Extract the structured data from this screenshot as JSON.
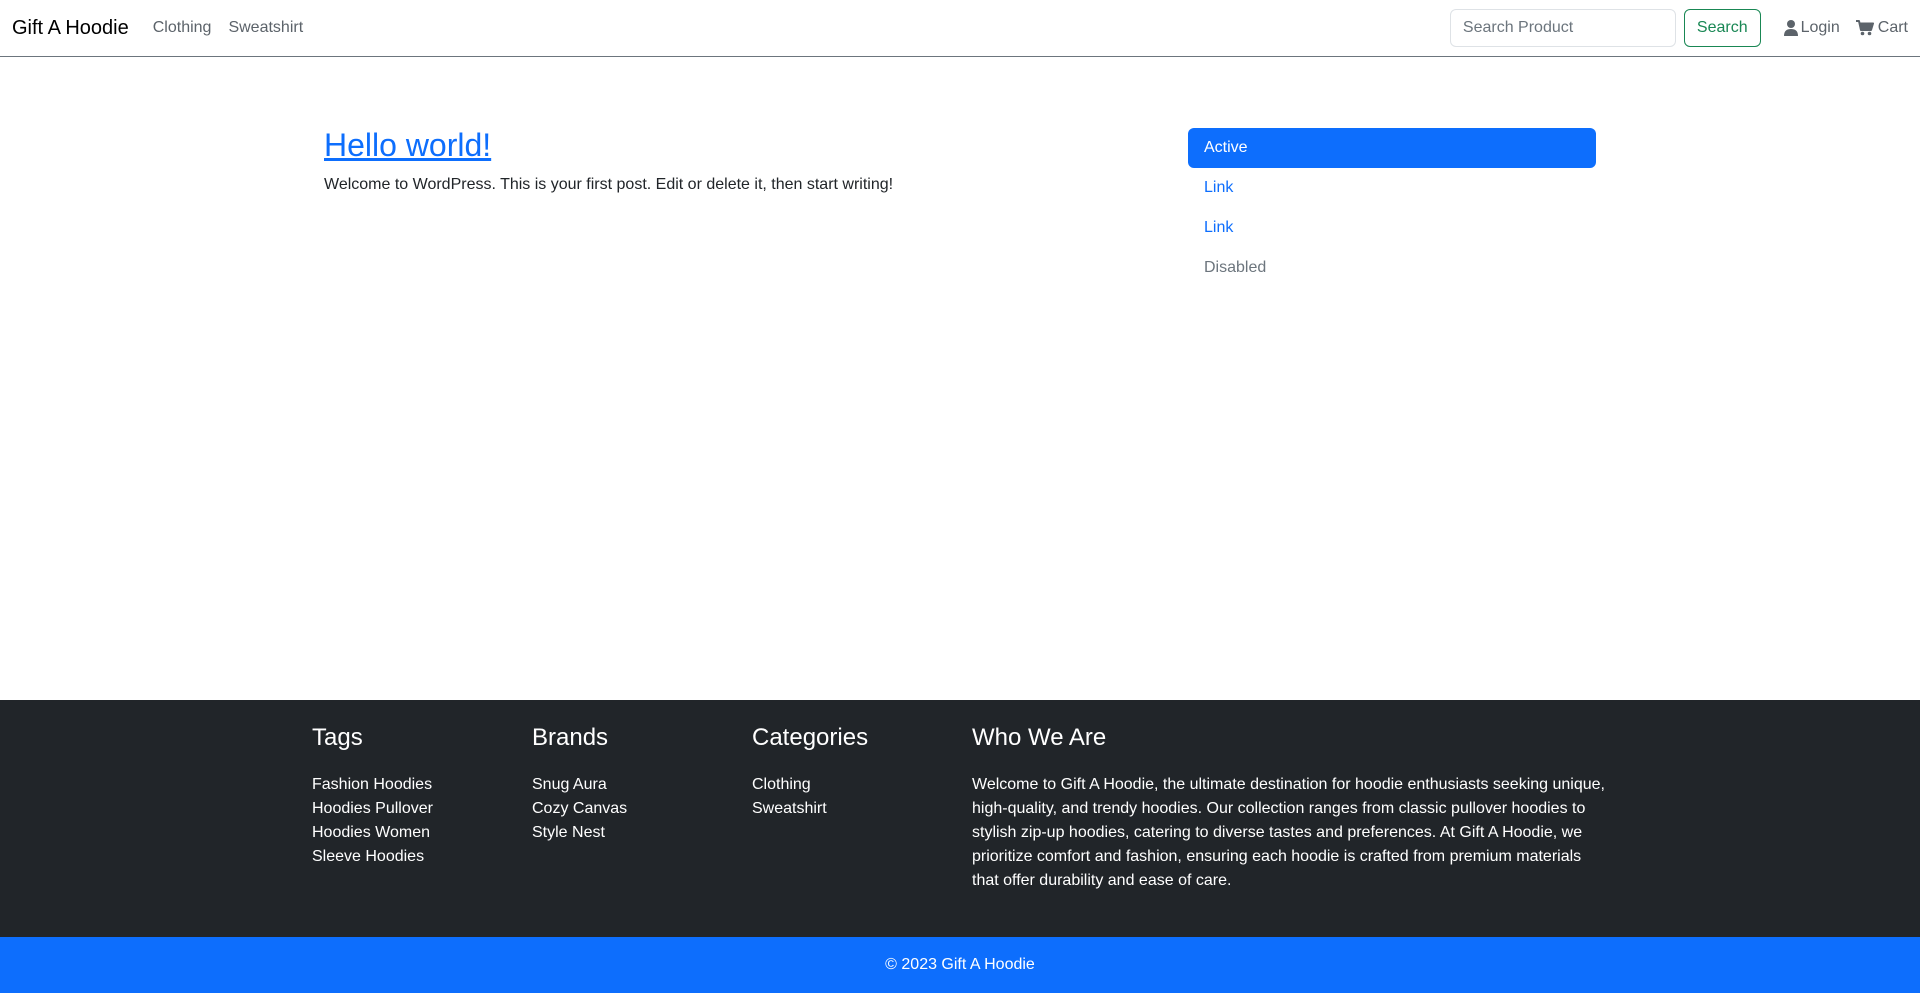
{
  "navbar": {
    "brand": "Gift A Hoodie",
    "links": [
      "Clothing",
      "Sweatshirt"
    ],
    "search_placeholder": "Search Product",
    "search_button": "Search",
    "login": "Login",
    "cart": "Cart"
  },
  "post": {
    "title": "Hello world!",
    "excerpt": "Welcome to WordPress. This is your first post. Edit or delete it, then start writing!"
  },
  "side_nav": {
    "items": [
      "Active",
      "Link",
      "Link",
      "Disabled"
    ]
  },
  "footer": {
    "tags": {
      "heading": "Tags",
      "items": [
        "Fashion Hoodies",
        "Hoodies Pullover",
        "Hoodies Women",
        "Sleeve Hoodies"
      ]
    },
    "brands": {
      "heading": "Brands",
      "items": [
        "Snug Aura",
        "Cozy Canvas",
        "Style Nest"
      ]
    },
    "categories": {
      "heading": "Categories",
      "items": [
        "Clothing",
        "Sweatshirt"
      ]
    },
    "about": {
      "heading": "Who We Are",
      "text": "Welcome to Gift A Hoodie, the ultimate destination for hoodie enthusiasts seeking unique, high-quality, and trendy hoodies. Our collection ranges from classic pullover hoodies to stylish zip-up hoodies, catering to diverse tastes and preferences. At Gift A Hoodie, we prioritize comfort and fashion, ensuring each hoodie is crafted from premium materials that offer durability and ease of care."
    }
  },
  "copyright": "© 2023 Gift A Hoodie",
  "icons": {
    "login": "user-icon",
    "cart": "cart-icon"
  },
  "colors": {
    "primary": "#0d6efd",
    "success": "#198754",
    "footer_bg": "#212529"
  }
}
